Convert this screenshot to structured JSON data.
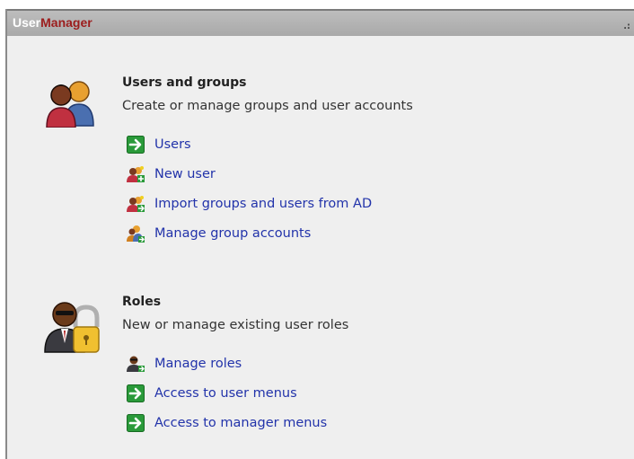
{
  "window": {
    "title_part1": "User",
    "title_part2": "Manager",
    "grip": ".:"
  },
  "users_section": {
    "icon": "users-group-icon",
    "heading": "Users and groups",
    "description": "Create or manage groups and user accounts",
    "links": [
      {
        "icon": "green-arrow-icon",
        "label": "Users"
      },
      {
        "icon": "new-user-icon",
        "label": "New user"
      },
      {
        "icon": "import-users-icon",
        "label": "Import groups and users from AD"
      },
      {
        "icon": "group-accounts-icon",
        "label": "Manage group accounts"
      }
    ]
  },
  "roles_section": {
    "icon": "user-lock-icon",
    "heading": "Roles",
    "description": "New or manage existing user roles",
    "links": [
      {
        "icon": "manage-roles-icon",
        "label": "Manage roles"
      },
      {
        "icon": "green-arrow-icon",
        "label": "Access to user menus"
      },
      {
        "icon": "green-arrow-icon",
        "label": "Access to manager menus"
      }
    ]
  },
  "colors": {
    "link": "#2233aa",
    "title_accent": "#9c1d1d",
    "arrow_green": "#2a9a3a"
  }
}
